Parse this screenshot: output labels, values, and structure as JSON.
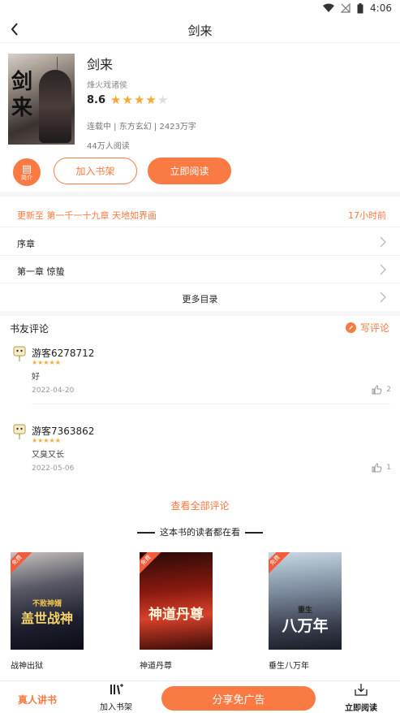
{
  "status_bar": {
    "time": "4:06"
  },
  "nav": {
    "title": "剑来"
  },
  "book": {
    "cover_text": "剑来",
    "title": "剑来",
    "author": "烽火戏诸侯",
    "rating": "8.6",
    "rating_stars": 4,
    "rating_max": 5,
    "meta": "连载中 | 东方玄幻 | 2423万字",
    "readers": "44万人阅读"
  },
  "actions": {
    "intro_label": "简介",
    "add_shelf": "加入书架",
    "read_now": "立即阅读"
  },
  "chapters": {
    "update_text": "更新至 第一千一十九章 天地如界画",
    "update_time": "17小时前",
    "items": [
      "序章",
      "第一章 惊蛰"
    ],
    "more": "更多目录"
  },
  "reviews": {
    "header": "书友评论",
    "write": "写评论",
    "items": [
      {
        "user": "游客6278712",
        "stars": 5,
        "text": "好",
        "date": "2022-04-20",
        "likes": "2"
      },
      {
        "user": "游客7363862",
        "stars": 5,
        "text": "又臭又长",
        "date": "2022-05-06",
        "likes": "1"
      }
    ],
    "see_all": "查看全部评论"
  },
  "recommend": {
    "header": "这本书的读者都在看",
    "items": [
      {
        "name": "战神出狱",
        "badge": "免费",
        "cover_text": "盖世战神",
        "cover_sub": "不败神婿"
      },
      {
        "name": "神道丹尊",
        "badge": "免费",
        "cover_text": "神道丹尊",
        "cover_sub": ""
      },
      {
        "name": "垂生八万年",
        "badge": "免费",
        "cover_text": "八万年",
        "cover_sub": "重生"
      }
    ]
  },
  "bottom_bar": {
    "tts": "真人讲书",
    "add_shelf": "加入书架",
    "share": "分享免广告",
    "read_now": "立即阅读"
  },
  "colors": {
    "accent": "#f97a42",
    "star": "#f8a932"
  }
}
